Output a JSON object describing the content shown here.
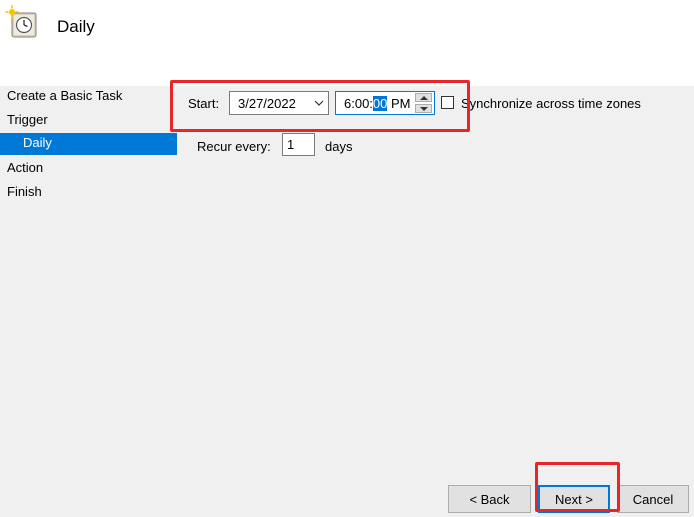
{
  "header": {
    "title": "Daily",
    "icon": "task-scheduler-clock-icon"
  },
  "nav": {
    "items": [
      {
        "label": "Create a Basic Task"
      },
      {
        "label": "Trigger"
      },
      {
        "label": "Daily"
      },
      {
        "label": "Action"
      },
      {
        "label": "Finish"
      }
    ],
    "selected": "Daily"
  },
  "start": {
    "label": "Start:",
    "date": "3/27/2022",
    "time_prefix": "6:00:",
    "time_selected": "00",
    "time_suffix": " PM",
    "sync_label": "Synchronize across time zones",
    "sync_checked": false
  },
  "recur": {
    "label": "Recur every:",
    "value": "1",
    "unit": "days"
  },
  "buttons": {
    "back": "< Back",
    "next": "Next >",
    "cancel": "Cancel"
  },
  "colors": {
    "accent": "#0078d7",
    "highlight_annotation": "#e8262a"
  }
}
